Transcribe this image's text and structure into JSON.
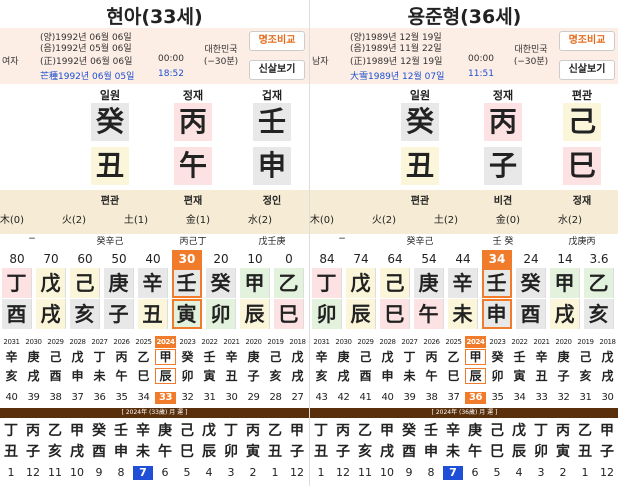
{
  "panels": [
    {
      "title": "현아(33세)",
      "gender": "여자",
      "dates": [
        "(양)1992년 06월 06일",
        "(음)1992년 05월 06일",
        "(正)1992년 06월 06일",
        "芒種1992년 06월 05일"
      ],
      "time1": "00:00",
      "time2": "18:52",
      "region": [
        "대한민국",
        "(−30분)"
      ],
      "btn1": "명조비교",
      "btn2": "신살보기",
      "pillars": [
        {
          "label": "",
          "top": "",
          "bottom": "",
          "top_color": "",
          "bottom_color": "",
          "sub": ""
        },
        {
          "label": "일원",
          "top": "癸",
          "bottom": "丑",
          "top_color": "gray",
          "bottom_color": "yellow",
          "sub": "편관"
        },
        {
          "label": "정재",
          "top": "丙",
          "bottom": "午",
          "top_color": "pink",
          "bottom_color": "pink",
          "sub": "편재"
        },
        {
          "label": "겁재",
          "top": "壬",
          "bottom": "申",
          "top_color": "gray",
          "bottom_color": "gray",
          "sub": "정인"
        }
      ],
      "ohang": [
        "木(0)",
        "火(2)",
        "土(1)",
        "金(1)",
        "水(2)"
      ],
      "jijang": [
        "−",
        "癸辛己",
        "丙己丁",
        "戊壬庚"
      ],
      "daeun_ages": [
        "80",
        "70",
        "60",
        "50",
        "40",
        "30",
        "20",
        "10",
        "0"
      ],
      "daeun_sel": 5,
      "daeun_top": [
        "丁",
        "戊",
        "己",
        "庚",
        "辛",
        "壬",
        "癸",
        "甲",
        "乙"
      ],
      "daeun_bottom": [
        "酉",
        "戌",
        "亥",
        "子",
        "丑",
        "寅",
        "卯",
        "辰",
        "巳"
      ],
      "daeun_top_colors": [
        "#fce2e2",
        "#fbf6d9",
        "#fbf6d9",
        "#e8e8e8",
        "#e8e8e8",
        "#e8e8e8",
        "#e8e8e8",
        "#e2f2dc",
        "#e2f2dc"
      ],
      "daeun_bottom_colors": [
        "#e8e8e8",
        "#fbf6d9",
        "#e8e8e8",
        "#e8e8e8",
        "#fbf6d9",
        "#e2f2dc",
        "#e2f2dc",
        "#fbf6d9",
        "#fce2e2"
      ],
      "years": [
        "2031",
        "2030",
        "2029",
        "2028",
        "2027",
        "2026",
        "2025",
        "2024",
        "2023",
        "2022",
        "2021",
        "2020",
        "2019",
        "2018"
      ],
      "year_sel": 7,
      "year_top": [
        "辛",
        "庚",
        "己",
        "戊",
        "丁",
        "丙",
        "乙",
        "甲",
        "癸",
        "壬",
        "辛",
        "庚",
        "己",
        "戊"
      ],
      "year_bottom": [
        "亥",
        "戌",
        "酉",
        "申",
        "未",
        "午",
        "巳",
        "辰",
        "卯",
        "寅",
        "丑",
        "子",
        "亥",
        "戌"
      ],
      "year_ages": [
        "40",
        "39",
        "38",
        "37",
        "36",
        "35",
        "34",
        "33",
        "32",
        "31",
        "30",
        "29",
        "28",
        "27"
      ],
      "month_title": "[ 2024年 (33歲) 月 運 ]",
      "month_top": [
        "丁",
        "丙",
        "乙",
        "甲",
        "癸",
        "壬",
        "辛",
        "庚",
        "己",
        "戊",
        "丁",
        "丙",
        "乙",
        "甲"
      ],
      "month_bottom": [
        "丑",
        "子",
        "亥",
        "戌",
        "酉",
        "申",
        "未",
        "午",
        "巳",
        "辰",
        "卯",
        "寅",
        "丑",
        "子"
      ],
      "month_nums": [
        "1",
        "12",
        "11",
        "10",
        "9",
        "8",
        "7",
        "6",
        "5",
        "4",
        "3",
        "2",
        "1",
        "12"
      ],
      "month_sel": 6
    },
    {
      "title": "용준형(36세)",
      "gender": "남자",
      "dates": [
        "(양)1989년 12월 19일",
        "(음)1989년 11월 22일",
        "(正)1989년 12월 19일",
        "大雪1989년 12월 07일"
      ],
      "time1": "00:00",
      "time2": "11:51",
      "region": [
        "대한민국",
        "(−30분)"
      ],
      "btn1": "명조비교",
      "btn2": "신살보기",
      "pillars": [
        {
          "label": "",
          "top": "",
          "bottom": "",
          "top_color": "",
          "bottom_color": "",
          "sub": ""
        },
        {
          "label": "일원",
          "top": "癸",
          "bottom": "丑",
          "top_color": "gray",
          "bottom_color": "yellow",
          "sub": "편관"
        },
        {
          "label": "정재",
          "top": "丙",
          "bottom": "子",
          "top_color": "pink",
          "bottom_color": "gray",
          "sub": "비견"
        },
        {
          "label": "편관",
          "top": "己",
          "bottom": "巳",
          "top_color": "yellow",
          "bottom_color": "pink",
          "sub": "정재"
        }
      ],
      "ohang": [
        "木(0)",
        "火(2)",
        "土(2)",
        "金(0)",
        "水(2)"
      ],
      "jijang": [
        "−",
        "癸辛己",
        "壬 癸",
        "戊庚丙"
      ],
      "daeun_ages": [
        "84",
        "74",
        "64",
        "54",
        "44",
        "34",
        "24",
        "14",
        "3.6"
      ],
      "daeun_sel": 5,
      "daeun_top": [
        "丁",
        "戊",
        "己",
        "庚",
        "辛",
        "壬",
        "癸",
        "甲",
        "乙"
      ],
      "daeun_bottom": [
        "卯",
        "辰",
        "巳",
        "午",
        "未",
        "申",
        "酉",
        "戌",
        "亥"
      ],
      "daeun_top_colors": [
        "#fce2e2",
        "#fbf6d9",
        "#fbf6d9",
        "#e8e8e8",
        "#e8e8e8",
        "#e8e8e8",
        "#e8e8e8",
        "#e2f2dc",
        "#e2f2dc"
      ],
      "daeun_bottom_colors": [
        "#e2f2dc",
        "#fbf6d9",
        "#fce2e2",
        "#fce2e2",
        "#fbf6d9",
        "#e8e8e8",
        "#e8e8e8",
        "#fbf6d9",
        "#e8e8e8"
      ],
      "years": [
        "2031",
        "2030",
        "2029",
        "2028",
        "2027",
        "2026",
        "2025",
        "2024",
        "2023",
        "2022",
        "2021",
        "2020",
        "2019",
        "2018"
      ],
      "year_sel": 7,
      "year_top": [
        "辛",
        "庚",
        "己",
        "戊",
        "丁",
        "丙",
        "乙",
        "甲",
        "癸",
        "壬",
        "辛",
        "庚",
        "己",
        "戊"
      ],
      "year_bottom": [
        "亥",
        "戌",
        "酉",
        "申",
        "未",
        "午",
        "巳",
        "辰",
        "卯",
        "寅",
        "丑",
        "子",
        "亥",
        "戌"
      ],
      "year_ages": [
        "43",
        "42",
        "41",
        "40",
        "39",
        "38",
        "37",
        "36",
        "35",
        "34",
        "33",
        "32",
        "31",
        "30"
      ],
      "month_title": "[ 2024年 (36歲) 月 運 ]",
      "month_top": [
        "丁",
        "丙",
        "乙",
        "甲",
        "癸",
        "壬",
        "辛",
        "庚",
        "己",
        "戊",
        "丁",
        "丙",
        "乙",
        "甲"
      ],
      "month_bottom": [
        "丑",
        "子",
        "亥",
        "戌",
        "酉",
        "申",
        "未",
        "午",
        "巳",
        "辰",
        "卯",
        "寅",
        "丑",
        "子"
      ],
      "month_nums": [
        "1",
        "12",
        "11",
        "10",
        "9",
        "8",
        "7",
        "6",
        "5",
        "4",
        "3",
        "2",
        "1",
        "12"
      ],
      "month_sel": 6
    }
  ],
  "colors": {
    "accent": "#f07c2b",
    "brand_orange": "#e36b1c",
    "blue": "#1f4fd6",
    "info_bg": "#fdeee5",
    "bar_brown": "#5a2f0c"
  }
}
